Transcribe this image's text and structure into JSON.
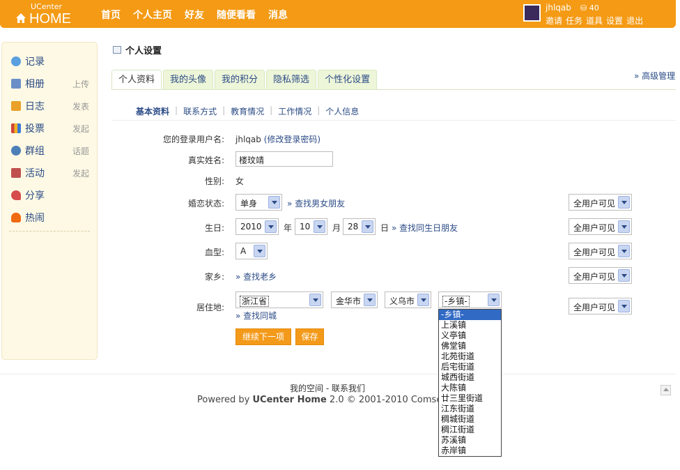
{
  "header": {
    "logo_small": "UCenter",
    "logo_big": "HOME",
    "nav": [
      "首页",
      "个人主页",
      "好友",
      "随便看看",
      "消息"
    ],
    "username": "jhlqab",
    "credit": "40",
    "user_links": [
      "邀请",
      "任务",
      "道具",
      "设置",
      "退出"
    ]
  },
  "sidebar": {
    "items": [
      {
        "label": "记录",
        "sub": "",
        "icon": "speech-bubble-icon",
        "color": "#5aa0e0"
      },
      {
        "label": "相册",
        "sub": "上传",
        "icon": "photo-icon",
        "color": "#6a8fc8"
      },
      {
        "label": "日志",
        "sub": "发表",
        "icon": "notebook-icon",
        "color": "#e9a12a"
      },
      {
        "label": "投票",
        "sub": "发起",
        "icon": "bar-chart-icon",
        "color": "#d2443a"
      },
      {
        "label": "群组",
        "sub": "话题",
        "icon": "group-icon",
        "color": "#4d7fb8"
      },
      {
        "label": "活动",
        "sub": "发起",
        "icon": "calendar-icon",
        "color": "#c0504d"
      },
      {
        "label": "分享",
        "sub": "",
        "icon": "heart-share-icon",
        "color": "#d64b4b"
      },
      {
        "label": "热闹",
        "sub": "",
        "icon": "fire-icon",
        "color": "#f06a10"
      }
    ]
  },
  "page": {
    "title": "个人设置",
    "advanced": "» 高级管理",
    "tabs": [
      "个人资料",
      "我的头像",
      "我的积分",
      "隐私筛选",
      "个性化设置"
    ],
    "subnav": [
      "基本资料",
      "联系方式",
      "教育情况",
      "工作情况",
      "个人信息"
    ]
  },
  "form": {
    "login_label": "您的登录用户名:",
    "login_value": "jhlqab",
    "login_link": "(修改登录密码)",
    "realname_label": "真实姓名:",
    "realname_value": "楼玟靖",
    "gender_label": "性别:",
    "gender_value": "女",
    "marital_label": "婚恋状态:",
    "marital_value": "单身",
    "marital_link": "» 查找男女朋友",
    "birthday_label": "生日:",
    "birth_year": "2010",
    "year_unit": "年",
    "birth_month": "10",
    "month_unit": "月",
    "birth_day": "28",
    "day_unit": "日",
    "birthday_link": "» 查找同生日朋友",
    "blood_label": "血型:",
    "blood_value": "A",
    "hometown_label": "家乡:",
    "hometown_link": "» 查找老乡",
    "residence_label": "居住地:",
    "province": "浙江省",
    "city": "金华市",
    "county": "义乌市",
    "town": "-乡镇-",
    "residence_link": "» 查找同城",
    "privacy": "全用户可见",
    "next_button": "继续下一项",
    "save_button": "保存"
  },
  "town_options": [
    "-乡镇-",
    "上溪镇",
    "义亭镇",
    "佛堂镇",
    "北苑街道",
    "后宅街道",
    "城西街道",
    "大陈镇",
    "廿三里街道",
    "江东街道",
    "稠城街道",
    "稠江街道",
    "苏溪镇",
    "赤岸镇"
  ],
  "footer": {
    "links": "我的空间 - 联系我们",
    "powered_prefix": "Powered by ",
    "powered_name": "UCenter Home",
    "powered_suffix": " 2.0 © 2001-2010 Comsenz"
  }
}
